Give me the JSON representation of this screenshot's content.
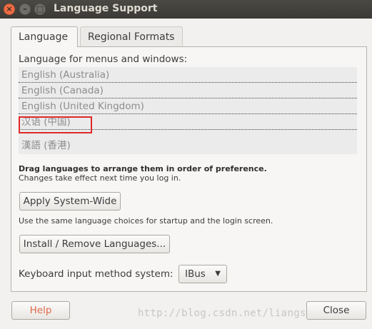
{
  "window": {
    "title": "Language Support"
  },
  "titlebar_buttons": {
    "close": "×",
    "minimize": "–",
    "maximize": "□"
  },
  "tabs": [
    {
      "label": "Language",
      "active": true
    },
    {
      "label": "Regional Formats",
      "active": false
    }
  ],
  "language": {
    "list_label": "Language for menus and windows:",
    "items": [
      "English (Australia)",
      "English (Canada)",
      "English (United Kingdom)",
      "汉语 (中国)",
      "漢語 (香港)"
    ],
    "highlighted_item": "汉语 (中国)",
    "drag_hint": "Drag languages to arrange them in order of preference.",
    "effect_hint": "Changes take effect next time you log in.",
    "apply_button": "Apply System-Wide",
    "apply_desc": "Use the same language choices for startup and the login screen.",
    "install_button": "Install / Remove Languages...",
    "keyboard_label": "Keyboard input method system:",
    "keyboard_value": "IBus"
  },
  "footer": {
    "help_button": "Help",
    "close_button": "Close"
  },
  "watermark": "http://blog.csdn.net/liangshilin",
  "colors": {
    "titlebar": "#3b3a36",
    "close_button": "#ef6d44",
    "highlight_border": "#e02828",
    "help_text": "#e06a4a"
  }
}
